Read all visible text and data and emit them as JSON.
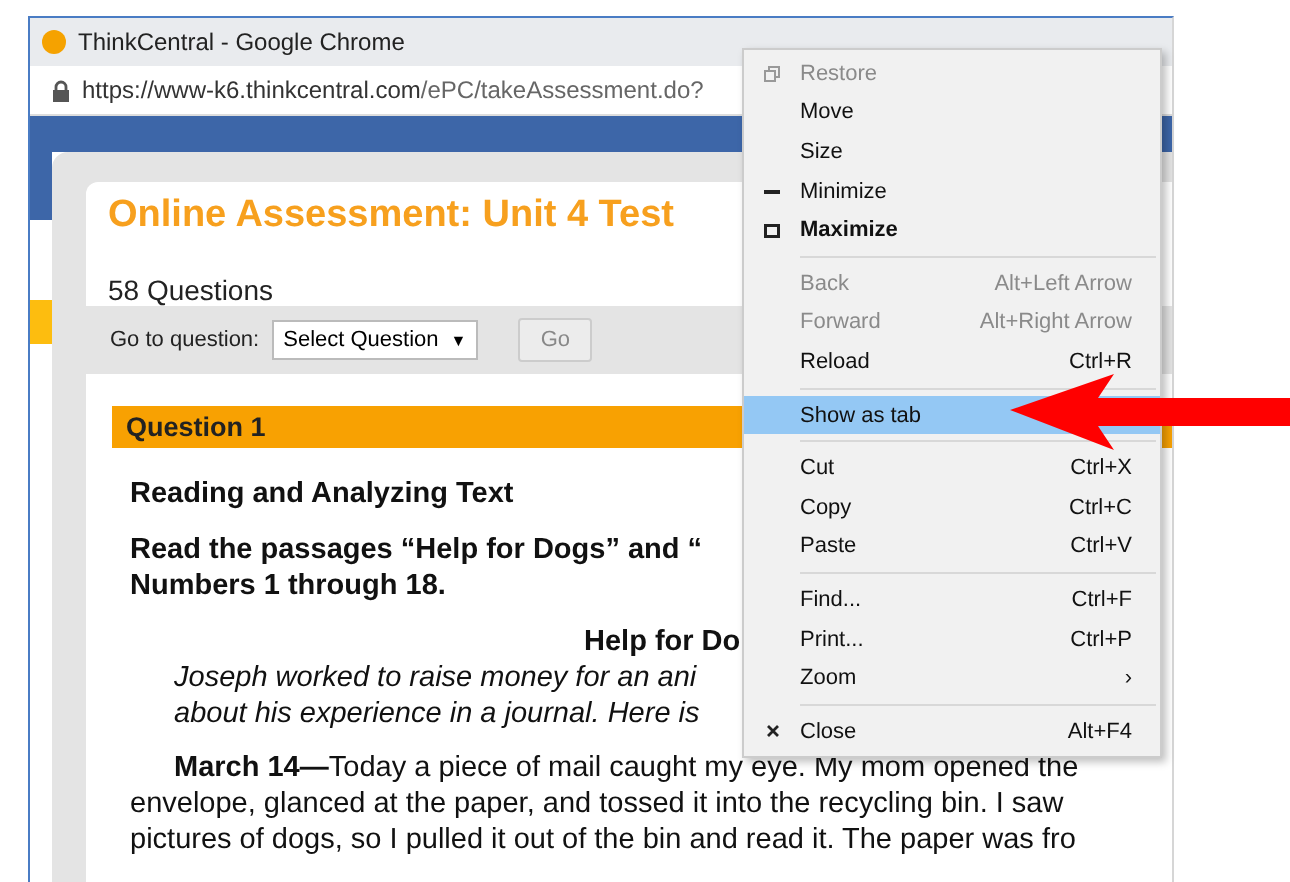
{
  "window": {
    "title": "ThinkCentral - Google Chrome",
    "url_host": "https://www-k6.thinkcentral.com",
    "url_path": "/ePC/takeAssessment.do?"
  },
  "assessment": {
    "title": "Online Assessment: Unit 4 Test",
    "count": "58 Questions",
    "goto_label": "Go to question:",
    "select_value": "Select Question",
    "select_caret": "▼",
    "go_button": "Go"
  },
  "question": {
    "label": "Question 1",
    "heading": "Reading and Analyzing Text",
    "instructions": [
      "Read the passages “Help for Dogs” and “",
      "Numbers 1 through 18."
    ],
    "passage_title": "Help for Do",
    "intro": [
      "Joseph worked to raise money for an ani",
      "about his experience in a journal. Here is"
    ],
    "paragraph": [
      "**March 14—**Today a piece of mail caught my eye. My mom opened the",
      "envelope, glanced at the paper, and tossed it into the recycling bin. I saw",
      "pictures of dogs, so I pulled it out of the bin and read it. The paper was fro"
    ]
  },
  "menu": [
    {
      "kind": "restore",
      "label": "Restore",
      "disabled": true,
      "bold": false,
      "selected": false
    },
    {
      "kind": "item",
      "label": "Move",
      "disabled": false,
      "bold": false,
      "selected": false
    },
    {
      "kind": "item",
      "label": "Size",
      "disabled": false,
      "bold": false,
      "selected": false
    },
    {
      "kind": "minimize",
      "label": "Minimize",
      "disabled": false,
      "bold": false,
      "selected": false
    },
    {
      "kind": "maximize",
      "label": "Maximize",
      "disabled": false,
      "bold": true,
      "selected": false
    },
    {
      "kind": "separator"
    },
    {
      "kind": "item",
      "label": "Back",
      "shortcut": "Alt+Left Arrow",
      "disabled": true,
      "bold": false,
      "selected": false
    },
    {
      "kind": "item",
      "label": "Forward",
      "shortcut": "Alt+Right Arrow",
      "disabled": true,
      "bold": false,
      "selected": false
    },
    {
      "kind": "item",
      "label": "Reload",
      "shortcut": "Ctrl+R",
      "disabled": false,
      "bold": false,
      "selected": false
    },
    {
      "kind": "separator"
    },
    {
      "kind": "item",
      "label": "Show as tab",
      "disabled": false,
      "bold": false,
      "selected": true
    },
    {
      "kind": "separator"
    },
    {
      "kind": "item",
      "label": "Cut",
      "shortcut": "Ctrl+X",
      "disabled": false,
      "bold": false,
      "selected": false
    },
    {
      "kind": "item",
      "label": "Copy",
      "shortcut": "Ctrl+C",
      "disabled": false,
      "bold": false,
      "selected": false
    },
    {
      "kind": "item",
      "label": "Paste",
      "shortcut": "Ctrl+V",
      "disabled": false,
      "bold": false,
      "selected": false
    },
    {
      "kind": "separator"
    },
    {
      "kind": "item",
      "label": "Find...",
      "shortcut": "Ctrl+F",
      "disabled": false,
      "bold": false,
      "selected": false
    },
    {
      "kind": "item",
      "label": "Print...",
      "shortcut": "Ctrl+P",
      "disabled": false,
      "bold": false,
      "selected": false
    },
    {
      "kind": "item",
      "label": "Zoom",
      "submenu": "›",
      "disabled": false,
      "bold": false,
      "selected": false
    },
    {
      "kind": "separator"
    },
    {
      "kind": "close",
      "label": "Close",
      "shortcut": "Alt+F4",
      "disabled": false,
      "bold": false,
      "selected": false
    }
  ]
}
